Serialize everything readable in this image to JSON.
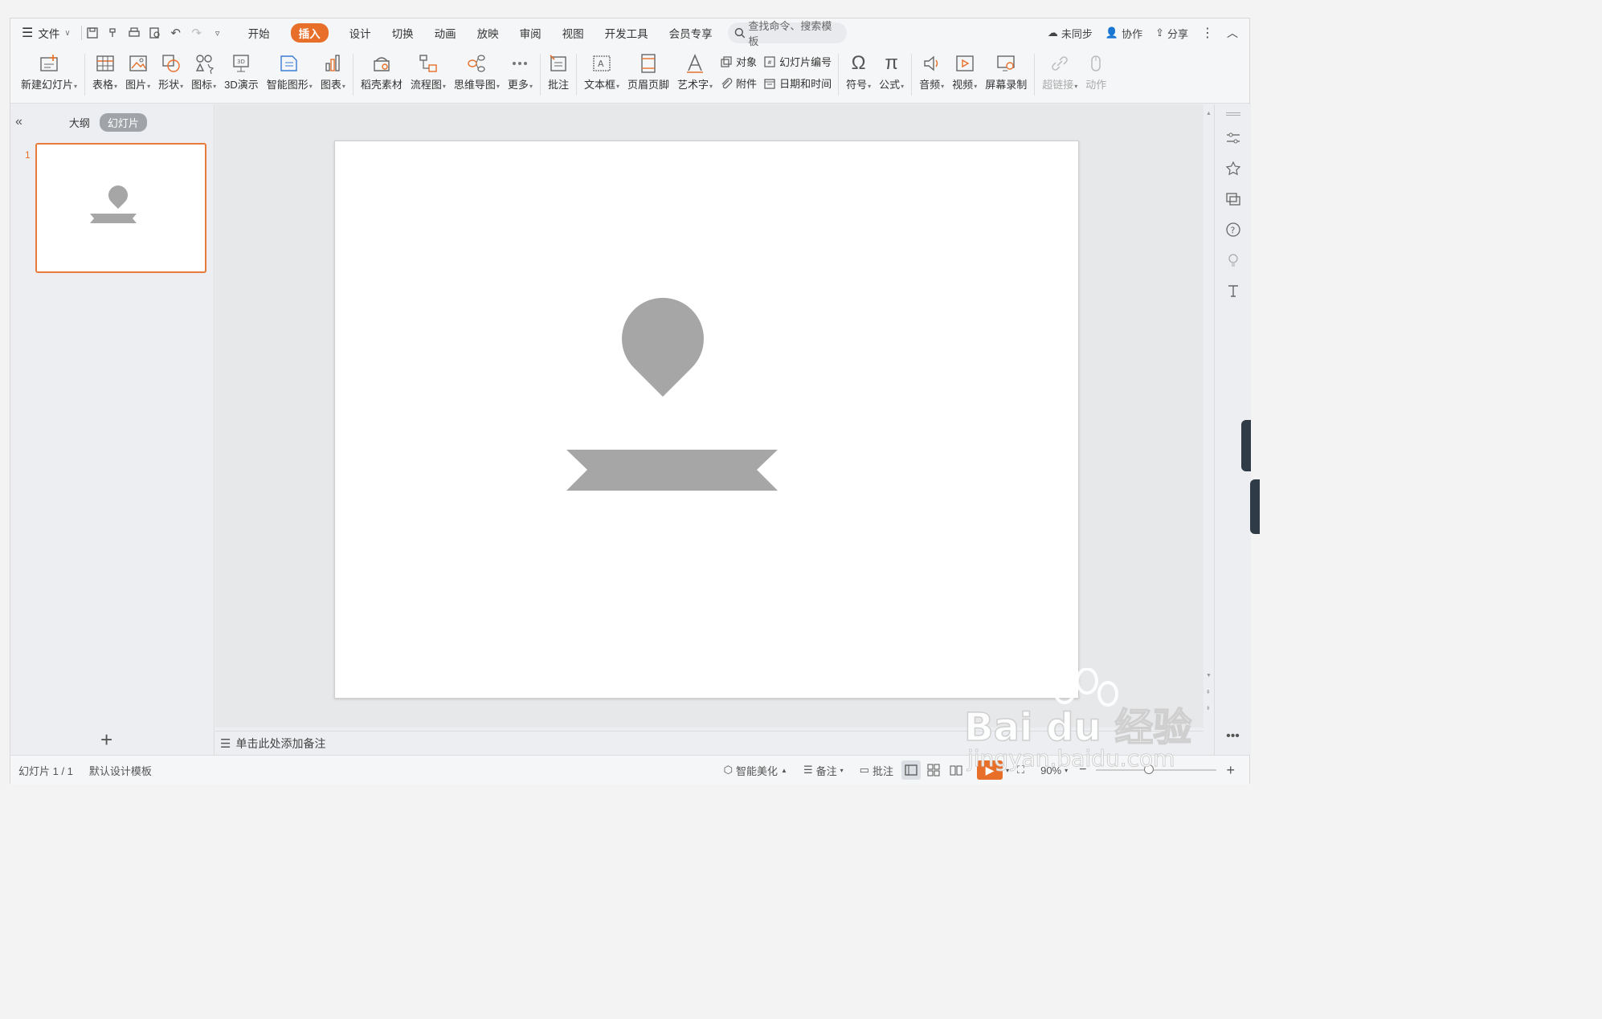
{
  "menu": {
    "file": "文件",
    "tabs": [
      "开始",
      "插入",
      "设计",
      "切换",
      "动画",
      "放映",
      "审阅",
      "视图",
      "开发工具",
      "会员专享"
    ],
    "active_tab": "插入",
    "search_placeholder": "查找命令、搜索模板",
    "right": {
      "sync": "未同步",
      "collab": "协作",
      "share": "分享"
    }
  },
  "ribbon": {
    "new_slide": "新建幻灯片",
    "table": "表格",
    "picture": "图片",
    "shape": "形状",
    "icon": "图标",
    "threed": "3D演示",
    "smartart": "智能图形",
    "chart": "图表",
    "material": "稻壳素材",
    "flowchart": "流程图",
    "mindmap": "思维导图",
    "more": "更多",
    "comment": "批注",
    "textbox": "文本框",
    "header_footer": "页眉页脚",
    "wordart": "艺术字",
    "object": "对象",
    "attachment": "附件",
    "slide_number": "幻灯片编号",
    "datetime": "日期和时间",
    "symbol": "符号",
    "formula": "公式",
    "audio": "音频",
    "video": "视频",
    "screen_record": "屏幕录制",
    "hyperlink": "超链接",
    "action": "动作"
  },
  "leftpanel": {
    "outline_tab": "大纲",
    "slides_tab": "幻灯片",
    "slide_index": "1"
  },
  "notes_placeholder": "单击此处添加备注",
  "status": {
    "slide_count": "幻灯片 1 / 1",
    "template": "默认设计模板",
    "beautify": "智能美化",
    "notes": "备注",
    "comment": "批注",
    "zoom": "90%"
  },
  "watermark": {
    "logo": "Bai du 经验",
    "url": "jingyan.baidu.com"
  },
  "colors": {
    "accent": "#e76f2a",
    "shape_gray": "#a6a6a6"
  }
}
